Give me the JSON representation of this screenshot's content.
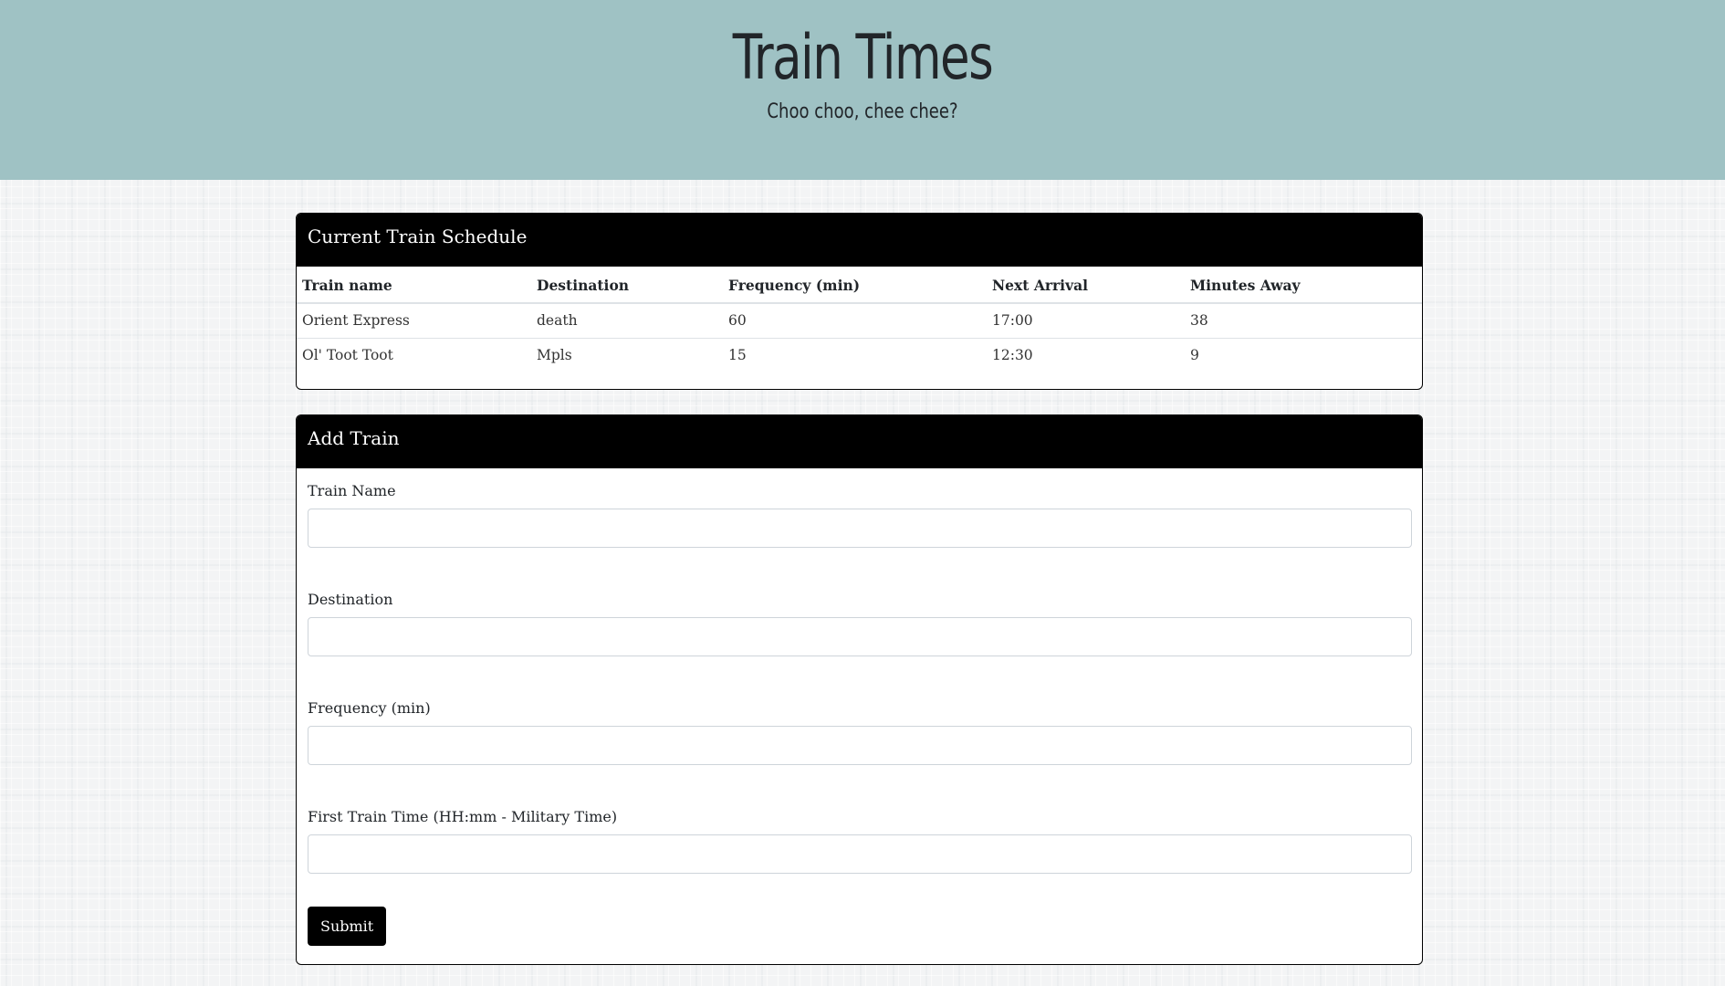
{
  "header": {
    "title": "Train Times",
    "subtitle": "Choo choo, chee chee?"
  },
  "schedule": {
    "title": "Current Train Schedule",
    "columns": [
      "Train name",
      "Destination",
      "Frequency (min)",
      "Next Arrival",
      "Minutes Away"
    ],
    "rows": [
      [
        "Orient Express",
        "death",
        "60",
        "17:00",
        "38"
      ],
      [
        "Ol' Toot Toot",
        "Mpls",
        "15",
        "12:30",
        "9"
      ]
    ]
  },
  "form": {
    "title": "Add Train",
    "fields": [
      {
        "label": "Train Name",
        "value": "",
        "placeholder": ""
      },
      {
        "label": "Destination",
        "value": "",
        "placeholder": ""
      },
      {
        "label": "Frequency (min)",
        "value": "",
        "placeholder": ""
      },
      {
        "label": "First Train Time (HH:mm - Military Time)",
        "value": "",
        "placeholder": ""
      }
    ],
    "submit_label": "Submit"
  },
  "colors": {
    "header_bg": "#9fc2c4",
    "card_header_bg": "#000000",
    "button_bg": "#000000"
  }
}
